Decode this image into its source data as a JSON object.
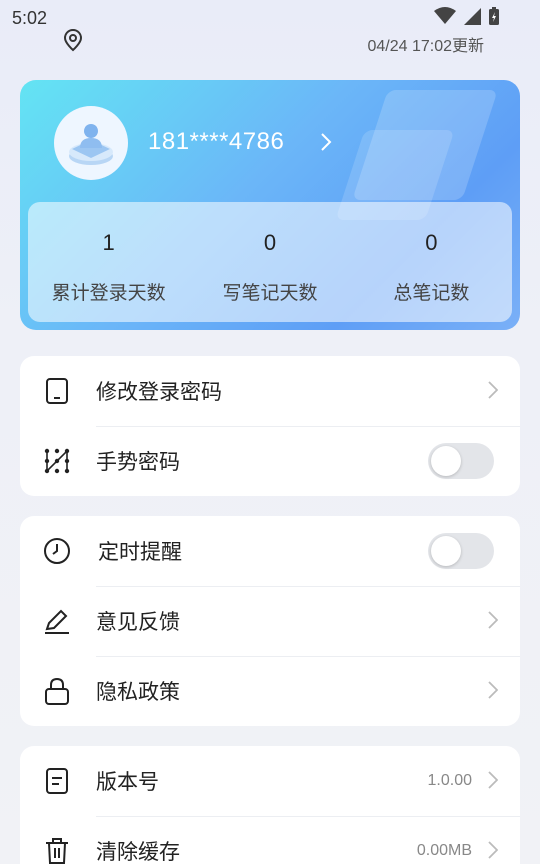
{
  "status_bar": {
    "time": "5:02",
    "update_text": "04/24 17:02更新"
  },
  "profile": {
    "phone": "181****4786"
  },
  "stats": [
    {
      "value": "1",
      "label": "累计登录天数"
    },
    {
      "value": "0",
      "label": "写笔记天数"
    },
    {
      "value": "0",
      "label": "总笔记数"
    }
  ],
  "security": {
    "change_password": "修改登录密码",
    "gesture_password": "手势密码",
    "gesture_enabled": false
  },
  "general": {
    "reminder": "定时提醒",
    "reminder_enabled": false,
    "feedback": "意见反馈",
    "privacy": "隐私政策"
  },
  "about": {
    "version_label": "版本号",
    "version_value": "1.0.00",
    "cache_label": "清除缓存",
    "cache_value": "0.00MB"
  },
  "colors": {
    "card_start": "#63e4f3",
    "card_end": "#5e9ef6",
    "toggle_off": "#e3e5e9"
  }
}
